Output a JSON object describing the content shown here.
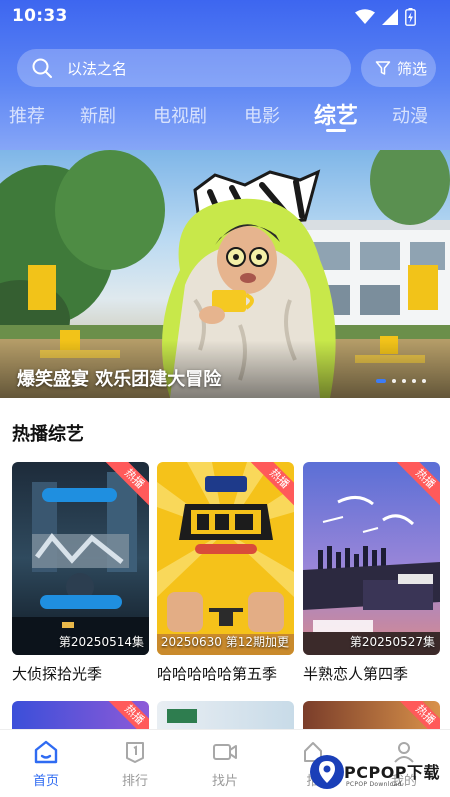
{
  "status_bar": {
    "time": "10:33"
  },
  "search": {
    "placeholder": "以法之名"
  },
  "filter": {
    "label": "筛选"
  },
  "tabs": [
    {
      "label": "推荐"
    },
    {
      "label": "新剧"
    },
    {
      "label": "电视剧"
    },
    {
      "label": "电影"
    },
    {
      "label": "综艺",
      "active": true
    },
    {
      "label": "动漫"
    }
  ],
  "banner": {
    "title": "爆笑盛宴 欢乐团建大冒险",
    "slide_count": 5,
    "active_slide": 1
  },
  "hot_section": {
    "title": "热播综艺",
    "cards": [
      {
        "title": "大侦探拾光季",
        "episode": "第20250514集",
        "tag": "热播"
      },
      {
        "title": "哈哈哈哈哈第五季",
        "episode": "20250630 第12期加更",
        "tag": "热播"
      },
      {
        "title": "半熟恋人第四季",
        "episode": "第20250527集",
        "tag": "热播"
      }
    ],
    "next_row_tags": [
      "热播",
      "",
      "热播"
    ]
  },
  "bottom_nav": [
    {
      "label": "首页",
      "icon": "home-icon",
      "active": true
    },
    {
      "label": "排行",
      "icon": "ranking-icon"
    },
    {
      "label": "找片",
      "icon": "video-camera-icon"
    },
    {
      "label": "推",
      "icon": "recommend-icon"
    },
    {
      "label": "我的",
      "icon": "user-icon"
    }
  ],
  "watermark": {
    "text": "PCPOP下载",
    "subtext": "PCPOP Download"
  },
  "colors": {
    "header_top": "#3d66f0",
    "accent": "#2f6bf2",
    "hot_tag": "#ff5a5a"
  }
}
